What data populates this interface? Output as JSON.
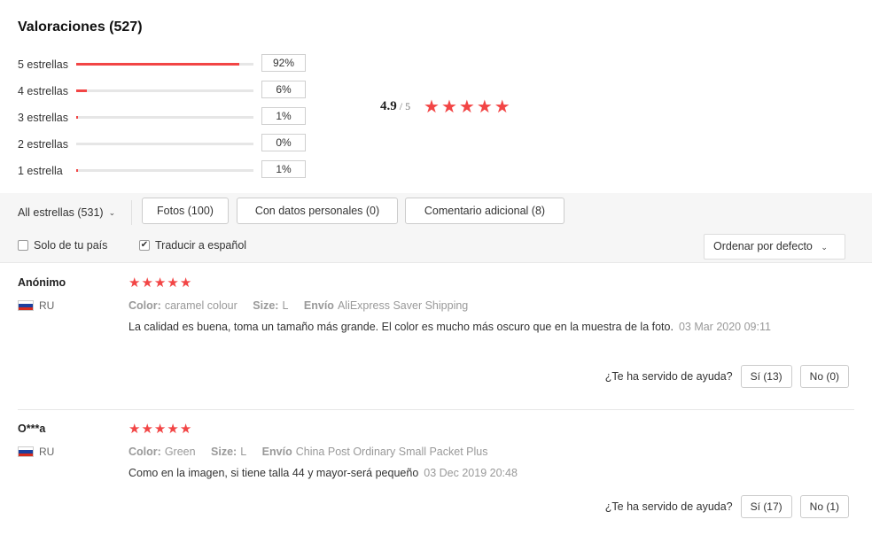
{
  "summary": {
    "title": "Valoraciones (527)",
    "distribution": [
      {
        "label": "5 estrellas",
        "percent_text": "92%",
        "fraction": 0.92
      },
      {
        "label": "4 estrellas",
        "percent_text": "6%",
        "fraction": 0.06
      },
      {
        "label": "3 estrellas",
        "percent_text": "1%",
        "fraction": 0.01
      },
      {
        "label": "2 estrellas",
        "percent_text": "0%",
        "fraction": 0.0
      },
      {
        "label": "1 estrella",
        "percent_text": "1%",
        "fraction": 0.01
      }
    ],
    "average": "4.9",
    "average_of": "/ 5",
    "average_stars": 5
  },
  "filters": {
    "all_stars": "All estrellas (531)",
    "photos": "Fotos (100)",
    "personal_data": "Con datos personales (0)",
    "additional": "Comentario adicional (8)",
    "only_country": "Solo de tu país",
    "only_country_checked": false,
    "translate": "Traducir a español",
    "translate_checked": true,
    "sort": "Ordenar por defecto"
  },
  "reviews": [
    {
      "name": "Anónimo",
      "country": "RU",
      "stars": 5,
      "color_label": "Color:",
      "color": "caramel colour",
      "size_label": "Size:",
      "size": "L",
      "shipping_label": "Envío",
      "shipping": "AliExpress Saver Shipping",
      "text": "La calidad es buena, toma un tamaño más grande. El color es mucho más oscuro que en la muestra de la foto.",
      "date": "03 Mar 2020 09:11",
      "helpful_question": "¿Te ha servido de ayuda?",
      "yes": "Sí (13)",
      "no": "No (0)"
    },
    {
      "name": "O***a",
      "country": "RU",
      "stars": 5,
      "color_label": "Color:",
      "color": "Green",
      "size_label": "Size:",
      "size": "L",
      "shipping_label": "Envío",
      "shipping": "China Post Ordinary Small Packet Plus",
      "text": "Como en la imagen, si tiene talla 44 y mayor-será pequeño",
      "date": "03 Dec 2019 20:48",
      "helpful_question": "¿Te ha servido de ayuda?",
      "yes": "Sí (17)",
      "no": "No (1)"
    }
  ],
  "colors": {
    "accent": "#f24545",
    "flag_white": "#ffffff",
    "flag_blue": "#1c3f9e",
    "flag_red": "#d52b1e"
  }
}
